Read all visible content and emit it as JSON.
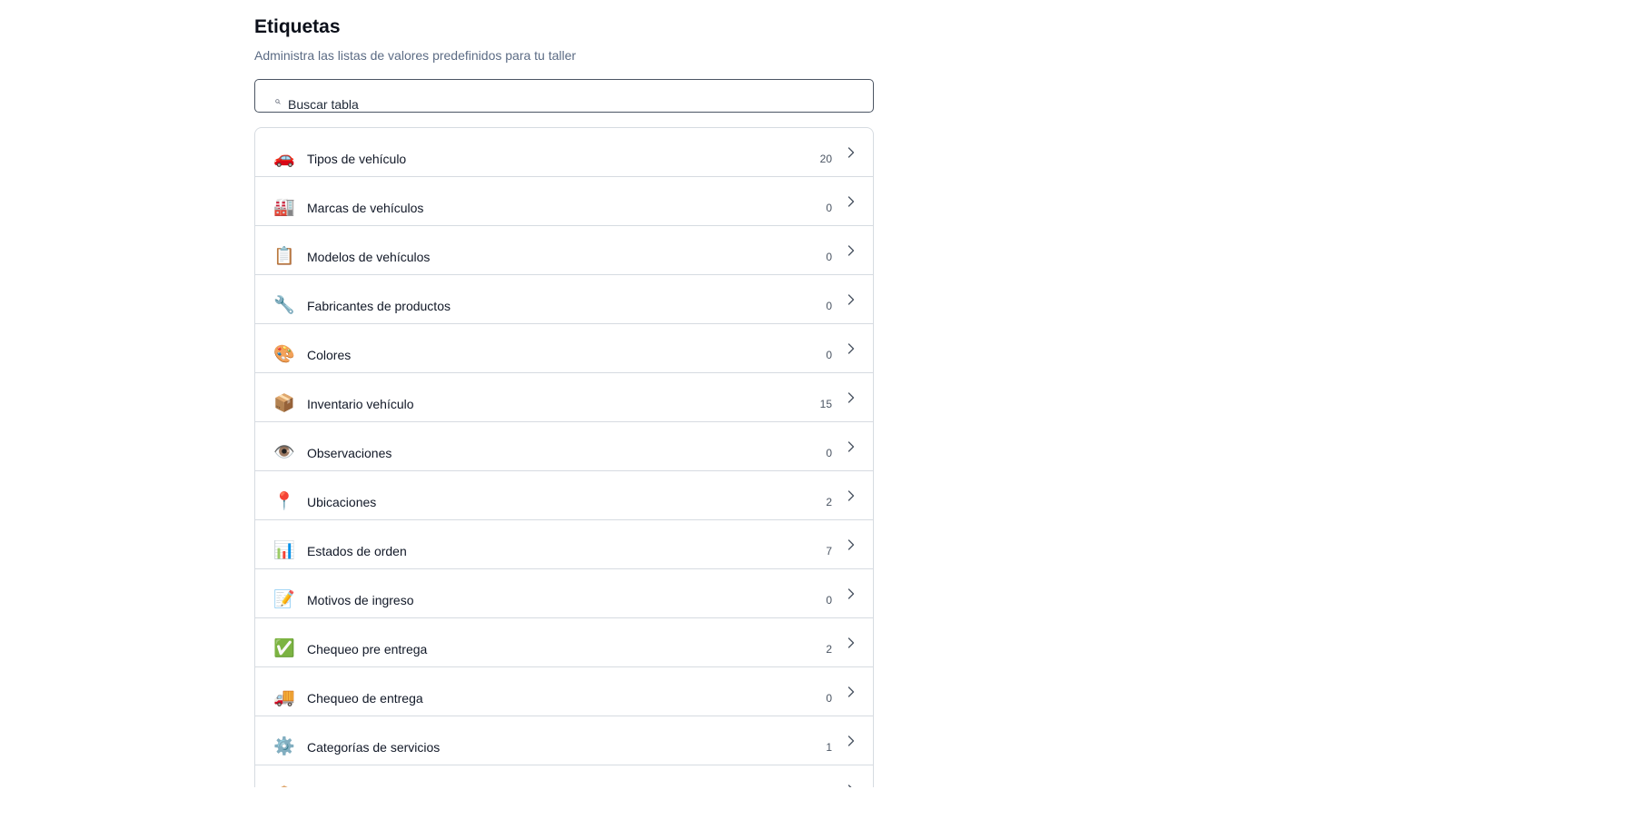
{
  "header": {
    "title": "Etiquetas",
    "subtitle": "Administra las listas de valores predefinidos para tu taller"
  },
  "search": {
    "placeholder": "Buscar tabla",
    "icon": "search-icon"
  },
  "tables": [
    {
      "id": "tipos-vehiculo",
      "label": "Tipos de vehículo",
      "count": "20",
      "icon": "🚗"
    },
    {
      "id": "marcas-vehiculos",
      "label": "Marcas de vehículos",
      "count": "0",
      "icon": "🏭"
    },
    {
      "id": "modelos-vehiculos",
      "label": "Modelos de vehículos",
      "count": "0",
      "icon": "📋"
    },
    {
      "id": "fabricantes-productos",
      "label": "Fabricantes de productos",
      "count": "0",
      "icon": "🔧"
    },
    {
      "id": "colores",
      "label": "Colores",
      "count": "0",
      "icon": "🎨"
    },
    {
      "id": "inventario-vehiculo",
      "label": "Inventario vehículo",
      "count": "15",
      "icon": "📦"
    },
    {
      "id": "observaciones",
      "label": "Observaciones",
      "count": "0",
      "icon": "👁️"
    },
    {
      "id": "ubicaciones",
      "label": "Ubicaciones",
      "count": "2",
      "icon": "📍"
    },
    {
      "id": "estados-orden",
      "label": "Estados de orden",
      "count": "7",
      "icon": "📊"
    },
    {
      "id": "motivos-ingreso",
      "label": "Motivos de ingreso",
      "count": "0",
      "icon": "📝"
    },
    {
      "id": "chequeo-pre-entrega",
      "label": "Chequeo pre entrega",
      "count": "2",
      "icon": "✅"
    },
    {
      "id": "chequeo-entrega",
      "label": "Chequeo de entrega",
      "count": "0",
      "icon": "🚚"
    },
    {
      "id": "categorias-servicios",
      "label": "Categorías de servicios",
      "count": "1",
      "icon": "⚙️"
    },
    {
      "id": "partially-visible-row",
      "label": "",
      "count": "",
      "icon": "📦"
    }
  ]
}
